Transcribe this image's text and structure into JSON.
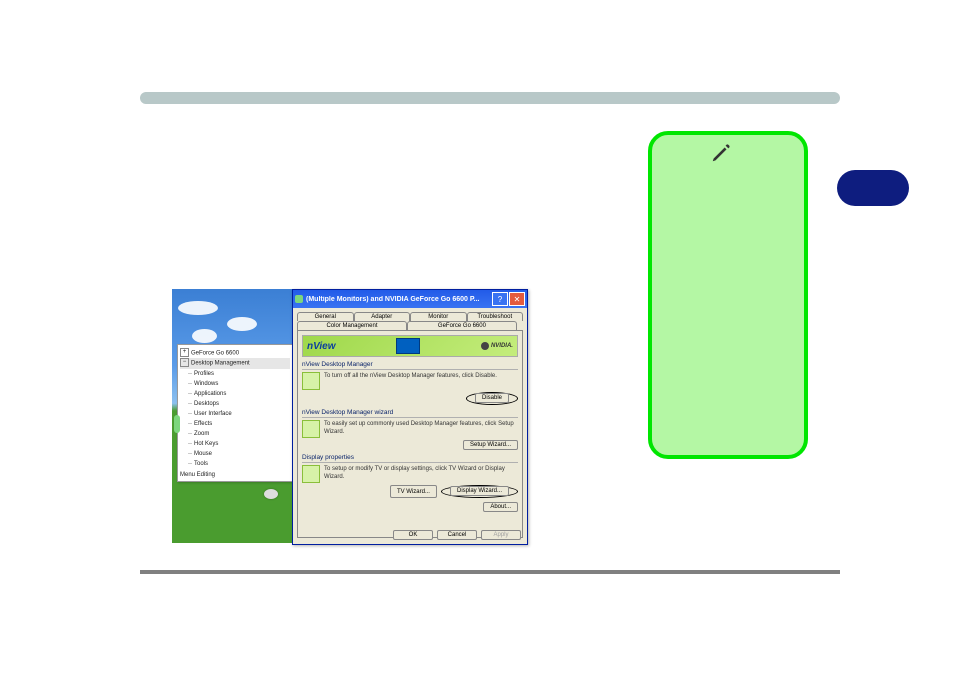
{
  "dialog": {
    "title": "(Multiple Monitors) and NVIDIA GeForce Go 6600 P...",
    "tabs_row1": [
      "General",
      "Adapter",
      "Monitor",
      "Troubleshoot"
    ],
    "tabs_row2": [
      "Color Management",
      "GeForce Go 6600"
    ],
    "banner_logo": "nView",
    "banner_brand": "NVIDIA.",
    "sections": {
      "nvdm": {
        "title": "nView Desktop Manager",
        "text": "To turn off all the nView Desktop Manager features, click Disable.",
        "button": "Disable"
      },
      "wizard": {
        "title": "nView Desktop Manager wizard",
        "text": "To easily set up commonly used Desktop Manager features, click Setup Wizard.",
        "button": "Setup Wizard..."
      },
      "dispprop": {
        "title": "Display properties",
        "text": "To setup or modify TV or display settings, click TV Wizard or Display Wizard.",
        "btn_tv": "TV Wizard...",
        "btn_dw": "Display Wizard..."
      },
      "about": "About..."
    },
    "footer": {
      "ok": "OK",
      "cancel": "Cancel",
      "apply": "Apply"
    }
  },
  "tree": {
    "root": "GeForce Go 6600",
    "selected": "Desktop Management",
    "children": [
      "Profiles",
      "Windows",
      "Applications",
      "Desktops",
      "User Interface",
      "Effects",
      "Zoom",
      "Hot Keys",
      "Mouse",
      "Tools"
    ],
    "last": "Menu Editing"
  }
}
